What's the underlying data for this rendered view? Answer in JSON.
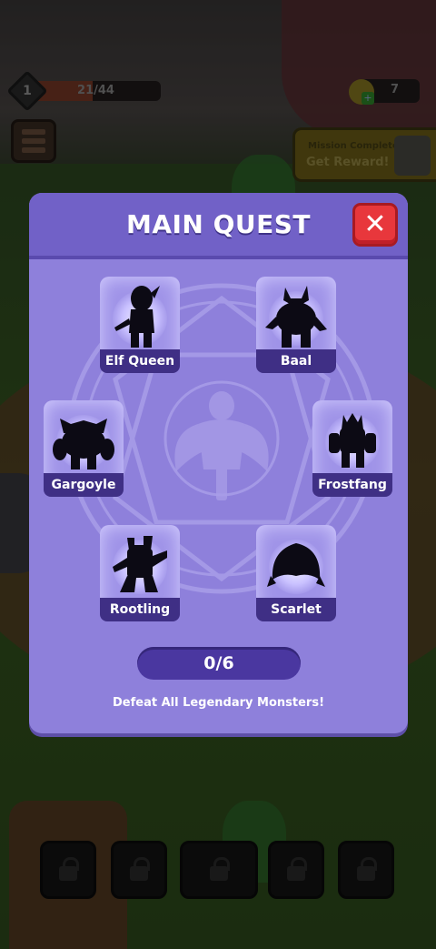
{
  "hud": {
    "level": "1",
    "xp_text": "21/44",
    "xp_progress": 0.477,
    "gem_count": "7",
    "gem_add_icon": "plus-icon",
    "menu_icon": "menu-icon"
  },
  "mission": {
    "title": "Mission Complete",
    "reward_label": "Get Reward!"
  },
  "quest": {
    "title": "MAIN QUEST",
    "close_label": "✕",
    "monsters": [
      {
        "name": "Elf Queen",
        "icon": "elf-queen-silhouette-icon"
      },
      {
        "name": "Baal",
        "icon": "baal-silhouette-icon"
      },
      {
        "name": "Gargoyle",
        "icon": "gargoyle-silhouette-icon"
      },
      {
        "name": "Frostfang",
        "icon": "frostfang-silhouette-icon"
      },
      {
        "name": "Rootling",
        "icon": "rootling-silhouette-icon"
      },
      {
        "name": "Scarlet",
        "icon": "scarlet-silhouette-icon"
      }
    ],
    "progress_text": "0/6",
    "progress_value": 0,
    "description": "Defeat All Legendary Monsters!"
  },
  "locked_slots": 5,
  "colors": {
    "panel": "#8e80db",
    "header": "#7161c7",
    "close": "#e8373c",
    "name_plate": "#3f2f85",
    "progress_track": "#4a37a0"
  }
}
